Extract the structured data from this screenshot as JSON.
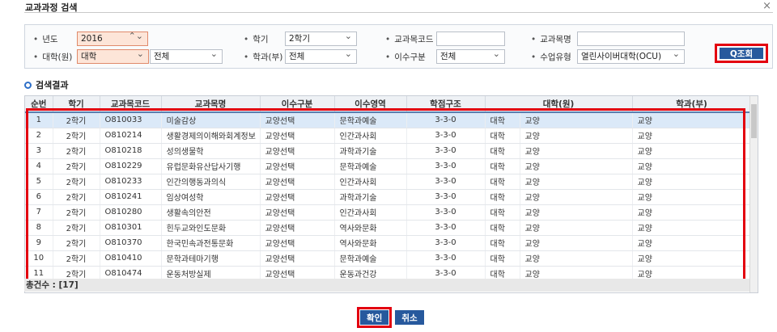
{
  "window": {
    "title": "교과과정 검색",
    "close_glyph": "×"
  },
  "search": {
    "year": {
      "label": "년도",
      "value": "2016"
    },
    "semester": {
      "label": "학기",
      "value": "2학기"
    },
    "course_code": {
      "label": "교과목코드",
      "value": ""
    },
    "course_name": {
      "label": "교과목명",
      "value": ""
    },
    "college": {
      "label": "대학(원)",
      "value": "대학",
      "sub_value": "전체"
    },
    "department": {
      "label": "학과(부)",
      "value": "전체"
    },
    "completion_type": {
      "label": "이수구분",
      "value": "전체"
    },
    "class_type": {
      "label": "수업유형",
      "value": "열린사이버대학(OCU)"
    },
    "query_button": "Q조회"
  },
  "results": {
    "title": "검색결과",
    "headers": [
      "순번",
      "학기",
      "교과목코드",
      "교과목명",
      "이수구분",
      "이수영역",
      "학점구조",
      "대학(원)",
      "학과(부)"
    ],
    "rows": [
      [
        "1",
        "2학기",
        "O810033",
        "미술감상",
        "교양선택",
        "문학과예술",
        "3-3-0",
        "대학",
        "교양",
        "교양"
      ],
      [
        "2",
        "2학기",
        "O810214",
        "생활경제의이해와회계정보",
        "교양선택",
        "인간과사회",
        "3-3-0",
        "대학",
        "교양",
        "교양"
      ],
      [
        "3",
        "2학기",
        "O810218",
        "성의생물학",
        "교양선택",
        "과학과기술",
        "3-3-0",
        "대학",
        "교양",
        "교양"
      ],
      [
        "4",
        "2학기",
        "O810229",
        "유럽문화유산답사기행",
        "교양선택",
        "문학과예술",
        "3-3-0",
        "대학",
        "교양",
        "교양"
      ],
      [
        "5",
        "2학기",
        "O810233",
        "인간의행동과의식",
        "교양선택",
        "인간과사회",
        "3-3-0",
        "대학",
        "교양",
        "교양"
      ],
      [
        "6",
        "2학기",
        "O810241",
        "임상여성학",
        "교양선택",
        "과학과기술",
        "3-3-0",
        "대학",
        "교양",
        "교양"
      ],
      [
        "7",
        "2학기",
        "O810280",
        "생활속의안전",
        "교양선택",
        "인간과사회",
        "3-3-0",
        "대학",
        "교양",
        "교양"
      ],
      [
        "8",
        "2학기",
        "O810301",
        "힌두교와인도문화",
        "교양선택",
        "역사와문화",
        "3-3-0",
        "대학",
        "교양",
        "교양"
      ],
      [
        "9",
        "2학기",
        "O810370",
        "한국민속과전통문화",
        "교양선택",
        "역사와문화",
        "3-3-0",
        "대학",
        "교양",
        "교양"
      ],
      [
        "10",
        "2학기",
        "O810410",
        "문학과테마기행",
        "교양선택",
        "문학과예술",
        "3-3-0",
        "대학",
        "교양",
        "교양"
      ],
      [
        "11",
        "2학기",
        "O810474",
        "운동처방실제",
        "교양선택",
        "운동과건강",
        "3-3-0",
        "대학",
        "교양",
        "교양"
      ]
    ],
    "total_label": "총건수 : [17]"
  },
  "footer": {
    "ok_button": "확인",
    "cancel_button": "취소"
  },
  "colors": {
    "accent": "#27599d",
    "highlight_border": "#e3000f",
    "selected_row": "#dbe9f8",
    "year_field": "#fde5d8"
  }
}
